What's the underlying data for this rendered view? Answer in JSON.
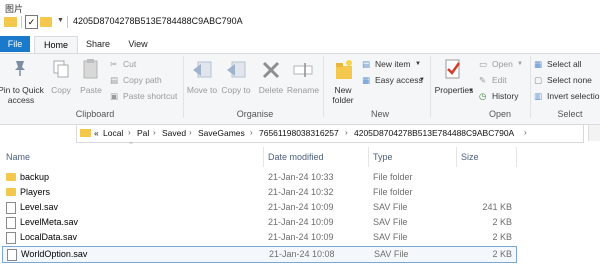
{
  "window": {
    "title": "图片",
    "path_label": "4205D8704278B513E784488C9ABC790A"
  },
  "tabs": {
    "file": "File",
    "home": "Home",
    "share": "Share",
    "view": "View"
  },
  "ribbon": {
    "clipboard": {
      "label": "Clipboard",
      "pin": "Pin to Quick access",
      "copy": "Copy",
      "paste": "Paste",
      "cut": "Cut",
      "copy_path": "Copy path",
      "paste_shortcut": "Paste shortcut"
    },
    "organise": {
      "label": "Organise",
      "move_to": "Move to",
      "copy_to": "Copy to",
      "delete": "Delete",
      "rename": "Rename"
    },
    "new": {
      "label": "New",
      "new_folder": "New folder",
      "new_item": "New item",
      "easy_access": "Easy access"
    },
    "open": {
      "label": "Open",
      "properties": "Properties",
      "open": "Open",
      "edit": "Edit",
      "history": "History"
    },
    "select": {
      "label": "Select",
      "select_all": "Select all",
      "select_none": "Select none",
      "invert": "Invert selection"
    }
  },
  "address": {
    "prefix": "«",
    "crumbs": [
      "Local",
      "Pal",
      "Saved",
      "SaveGames",
      "76561198038316257",
      "4205D8704278B513E784488C9ABC790A"
    ]
  },
  "columns": {
    "name": "Name",
    "date": "Date modified",
    "type": "Type",
    "size": "Size"
  },
  "files": [
    {
      "name": "backup",
      "date": "21-Jan-24 10:33",
      "type": "File folder",
      "size": "",
      "kind": "folder"
    },
    {
      "name": "Players",
      "date": "21-Jan-24 10:32",
      "type": "File folder",
      "size": "",
      "kind": "folder"
    },
    {
      "name": "Level.sav",
      "date": "21-Jan-24 10:09",
      "type": "SAV File",
      "size": "241 KB",
      "kind": "file"
    },
    {
      "name": "LevelMeta.sav",
      "date": "21-Jan-24 10:09",
      "type": "SAV File",
      "size": "2 KB",
      "kind": "file"
    },
    {
      "name": "LocalData.sav",
      "date": "21-Jan-24 10:09",
      "type": "SAV File",
      "size": "2 KB",
      "kind": "file"
    },
    {
      "name": "WorldOption.sav",
      "date": "21-Jan-24 10:08",
      "type": "SAV File",
      "size": "2 KB",
      "kind": "file"
    }
  ],
  "colors": {
    "accent": "#1979ca",
    "folder": "#f4c84d",
    "selection_border": "#7aa7d6"
  }
}
